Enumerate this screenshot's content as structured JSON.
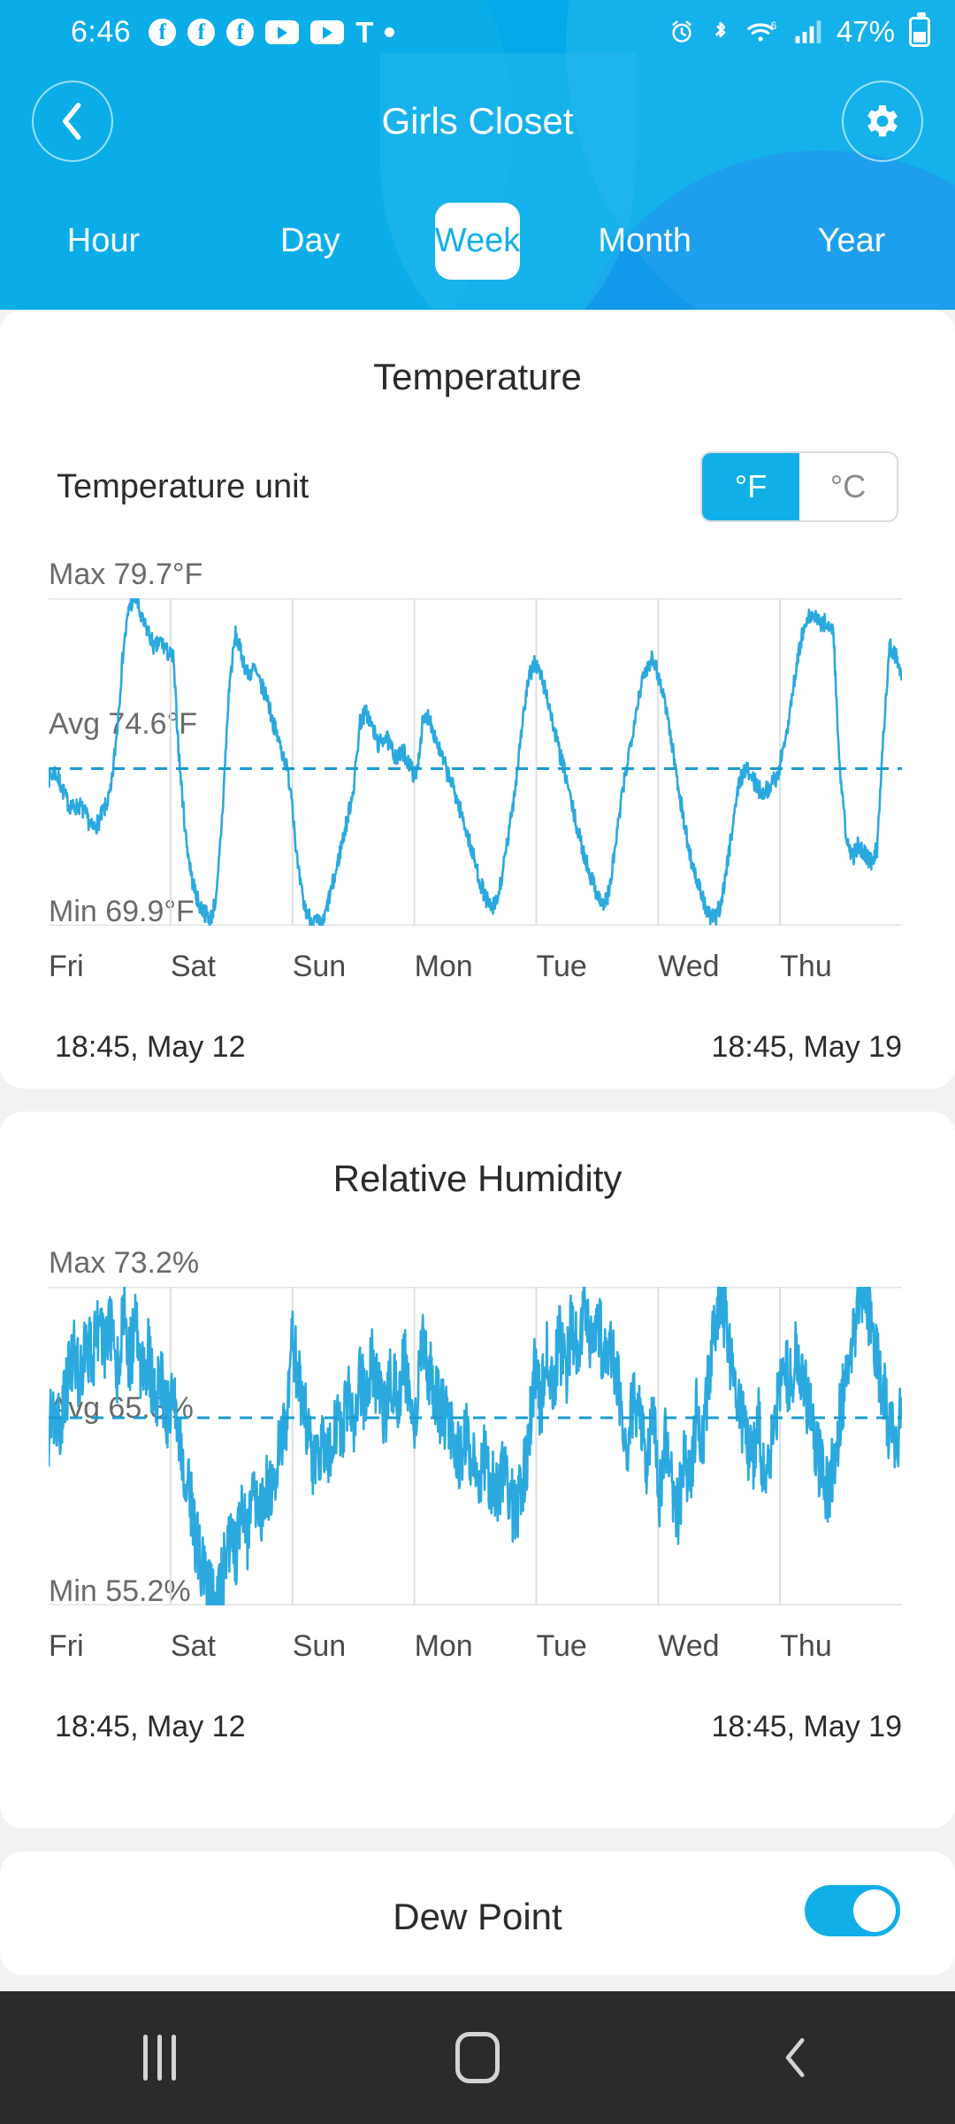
{
  "status_bar": {
    "time": "6:46",
    "left_icons": [
      "facebook-icon",
      "facebook-icon",
      "facebook-icon",
      "youtube-icon",
      "youtube-icon",
      "tmobile-icon",
      "dot-icon"
    ],
    "carrier": "T",
    "right_icons": [
      "alarm-icon",
      "bluetooth-icon",
      "wifi-icon",
      "signal-icon"
    ],
    "battery_percent": "47%"
  },
  "header": {
    "title": "Girls Closet",
    "back_icon": "chevron-left-icon",
    "settings_icon": "gear-icon"
  },
  "tabs": {
    "items": [
      "Hour",
      "Day",
      "Week",
      "Month",
      "Year"
    ],
    "selected": "Week"
  },
  "temperature_card": {
    "title": "Temperature",
    "unit_label": "Temperature unit",
    "unit_options": [
      "°F",
      "°C"
    ],
    "unit_selected": "°F",
    "max_label": "Max 79.7°F",
    "avg_label": "Avg 74.6°F",
    "min_label": "Min 69.9°F",
    "start_time": "18:45,  May 12",
    "end_time": "18:45,  May 19"
  },
  "humidity_card": {
    "title": "Relative Humidity",
    "max_label": "Max 73.2%",
    "avg_label": "Avg 65.8%",
    "min_label": "Min 55.2%",
    "start_time": "18:45,  May 12",
    "end_time": "18:45,  May 19"
  },
  "dew_point_card": {
    "title": "Dew Point",
    "toggle_on": true
  },
  "nav_bar": {
    "recents_icon": "recents-icon",
    "home_icon": "home-icon",
    "back_icon": "back-chevron-icon"
  },
  "colors": {
    "brand_blue": "#03a9e8",
    "accent_blue": "#11afe8",
    "series_blue": "#2ba9df",
    "card_bg": "#ffffff",
    "page_bg": "#f1f2f2"
  },
  "chart_data": [
    {
      "type": "line",
      "title": "Temperature",
      "ylabel": "°F",
      "xlabel": "",
      "unit": "°F",
      "ylim": [
        69.9,
        79.7
      ],
      "max": 79.7,
      "avg": 74.6,
      "min": 69.9,
      "grid": true,
      "legend": "none",
      "categories": [
        "Fri",
        "Sat",
        "Sun",
        "Mon",
        "Tue",
        "Wed",
        "Thu"
      ],
      "x_range": [
        "18:45,  May 12",
        "18:45,  May 19"
      ],
      "avg_line": 74.6,
      "values": [
        74.3,
        74.5,
        74.1,
        73.6,
        73.4,
        73.5,
        73.2,
        72.8,
        73.0,
        73.4,
        73.9,
        75.8,
        78.2,
        79.5,
        79.7,
        79.0,
        78.7,
        78.2,
        78.4,
        78.1,
        77.9,
        74.8,
        72.6,
        71.3,
        70.6,
        70.3,
        70.1,
        70.8,
        73.6,
        77.1,
        78.6,
        78.0,
        77.4,
        77.6,
        77.1,
        76.8,
        76.0,
        75.4,
        74.8,
        73.9,
        71.6,
        70.5,
        70.1,
        70.0,
        69.9,
        70.7,
        71.4,
        72.3,
        73.1,
        74.1,
        76.0,
        76.3,
        75.8,
        75.3,
        75.6,
        75.2,
        74.9,
        75.1,
        74.7,
        74.3,
        75.9,
        76.2,
        75.6,
        75.0,
        74.5,
        74.0,
        73.4,
        72.8,
        72.1,
        71.4,
        70.8,
        70.4,
        70.6,
        71.6,
        72.8,
        74.2,
        75.9,
        77.2,
        77.8,
        77.4,
        76.8,
        75.9,
        75.1,
        74.4,
        73.5,
        72.7,
        72.0,
        71.4,
        70.9,
        70.5,
        70.9,
        72.3,
        73.7,
        74.9,
        76.0,
        77.0,
        77.6,
        78.0,
        77.3,
        76.6,
        75.4,
        74.2,
        73.0,
        72.0,
        71.3,
        70.7,
        70.2,
        70.1,
        70.6,
        71.8,
        73.2,
        74.3,
        74.6,
        74.3,
        74.0,
        73.9,
        74.1,
        74.4,
        75.2,
        76.3,
        77.6,
        78.6,
        79.1,
        79.2,
        78.9,
        79.0,
        78.7,
        74.6,
        72.6,
        71.9,
        72.3,
        72.1,
        71.8,
        72.2,
        75.6,
        78.3,
        78.0,
        77.4
      ]
    },
    {
      "type": "line",
      "title": "Relative Humidity",
      "ylabel": "%",
      "xlabel": "",
      "unit": "%",
      "ylim": [
        55.2,
        73.2
      ],
      "max": 73.2,
      "avg": 65.8,
      "min": 55.2,
      "grid": true,
      "legend": "none",
      "categories": [
        "Fri",
        "Sat",
        "Sun",
        "Mon",
        "Tue",
        "Wed",
        "Thu"
      ],
      "x_range": [
        "18:45,  May 12",
        "18:45,  May 19"
      ],
      "avg_line": 65.8,
      "values": [
        64.9,
        66.2,
        65.4,
        67.8,
        69.6,
        68.2,
        70.4,
        69.1,
        71.2,
        69.8,
        70.9,
        68.4,
        71.6,
        69.2,
        70.8,
        67.9,
        69.4,
        66.8,
        68.2,
        65.9,
        66.8,
        64.2,
        63.1,
        60.4,
        58.2,
        56.6,
        55.9,
        55.2,
        56.8,
        59.2,
        58.1,
        60.4,
        59.2,
        61.8,
        60.2,
        62.4,
        61.1,
        63.8,
        65.2,
        70.1,
        68.4,
        66.2,
        64.1,
        62.8,
        65.2,
        63.4,
        66.1,
        64.2,
        67.3,
        65.1,
        68.2,
        66.4,
        69.1,
        67.2,
        66.1,
        68.4,
        66.8,
        69.2,
        67.1,
        65.9,
        70.2,
        68.4,
        67.1,
        66.2,
        65.4,
        64.6,
        63.8,
        64.9,
        63.2,
        62.4,
        63.6,
        62.1,
        61.4,
        62.8,
        61.2,
        60.4,
        61.8,
        64.2,
        68.4,
        66.2,
        69.8,
        67.4,
        70.2,
        68.1,
        71.4,
        69.2,
        72.1,
        70.4,
        71.8,
        69.6,
        70.2,
        68.4,
        66.2,
        64.1,
        67.2,
        65.4,
        63.2,
        66.8,
        61.2,
        64.4,
        62.1,
        60.2,
        63.4,
        61.8,
        66.2,
        64.1,
        68.4,
        71.2,
        73.0,
        70.2,
        68.4,
        66.2,
        64.8,
        63.1,
        65.4,
        62.2,
        64.6,
        66.8,
        69.2,
        67.4,
        70.1,
        68.2,
        66.4,
        64.2,
        62.8,
        61.4,
        63.2,
        65.8,
        68.4,
        70.2,
        72.4,
        73.2,
        71.4,
        69.2,
        67.4,
        65.2,
        63.8,
        66.2
      ]
    }
  ]
}
